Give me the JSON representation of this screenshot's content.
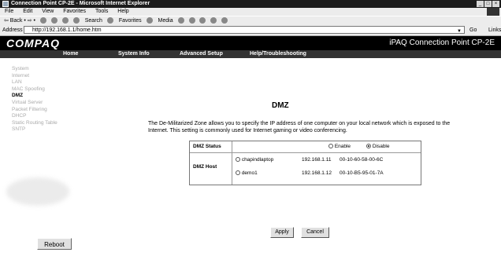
{
  "window": {
    "title": "Connection Point CP-2E - Microsoft Internet Explorer",
    "buttons": [
      "_",
      "□",
      "×"
    ]
  },
  "menu": [
    "File",
    "Edit",
    "View",
    "Favorites",
    "Tools",
    "Help"
  ],
  "toolbar": {
    "back": "⇦ Back • ⇨ •",
    "search": "Search",
    "favorites": "Favorites",
    "media": "Media"
  },
  "address": {
    "label": "Address",
    "url": "http://192.168.1.1/home.htm",
    "go": "Go",
    "links": "Links"
  },
  "page": {
    "logo": "COMPAQ",
    "product": "iPAQ Connection Point CP-2E",
    "nav": [
      "Home",
      "System Info",
      "Advanced Setup",
      "Help/Troubleshooting"
    ],
    "sidebar": [
      "System",
      "Internet",
      "LAN",
      "MAC Spoofing",
      "DMZ",
      "Virtual Server",
      "Packet Filtering",
      "DHCP",
      "Static Routing Table",
      "SNTP"
    ],
    "heading": "DMZ",
    "description": "The De-Militarized Zone allows you to specify the IP address of one computer on your local network which is exposed to the Internet. This setting is commonly used for Internet gaming or video conferencing.",
    "status_label": "DMZ Status",
    "enable": "Enable",
    "disable": "Disable",
    "host_label": "DMZ Host",
    "hosts": [
      {
        "name": "chapindlaptop",
        "ip": "192.168.1.11",
        "mac": "00-10-60-58-00-6C"
      },
      {
        "name": "demo1",
        "ip": "192.168.1.12",
        "mac": "00-10-B5-95-01-7A"
      }
    ],
    "apply": "Apply",
    "cancel": "Cancel",
    "reboot": "Reboot"
  }
}
